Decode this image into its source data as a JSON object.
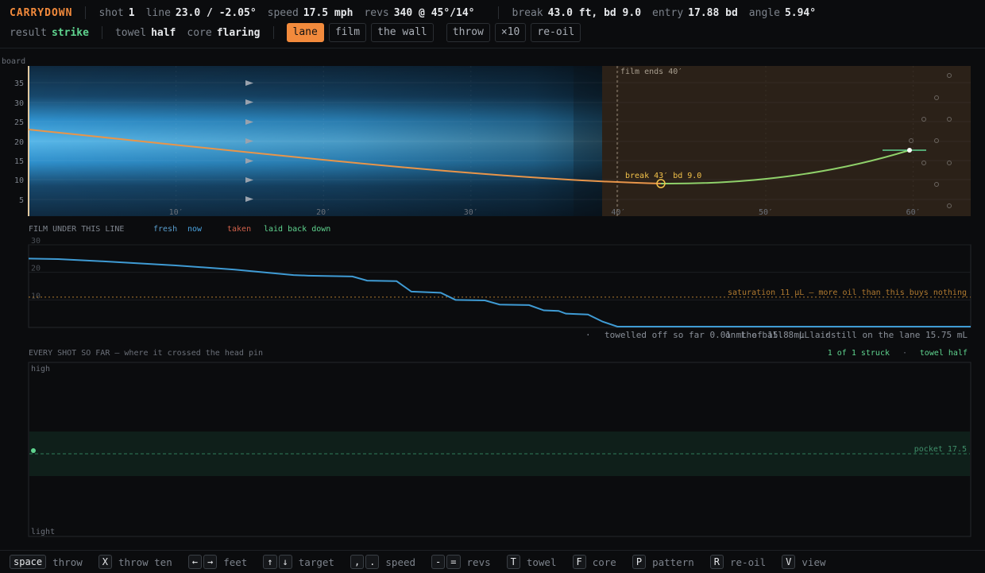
{
  "header": {
    "brand": "CARRYDOWN",
    "shot_label": "shot",
    "shot": "1",
    "line_label": "line",
    "line": "23.0 / -2.05°",
    "speed_label": "speed",
    "speed": "17.5 mph",
    "revs_label": "revs",
    "revs": "340 @ 45°/14°",
    "break_label": "break",
    "break": "43.0 ft, bd 9.0",
    "entry_label": "entry",
    "entry": "17.88 bd",
    "angle_label": "angle",
    "angle": "5.94°",
    "result_label": "result",
    "result": "strike",
    "towel_label": "towel",
    "towel": "half",
    "core_label": "core",
    "core": "flaring",
    "buttons": {
      "lane": "lane",
      "film": "film",
      "wall": "the wall",
      "throw": "throw",
      "x10": "×10",
      "reoil": "re-oil"
    }
  },
  "lane": {
    "axis_label": "board",
    "board_ticks": [
      "35",
      "30",
      "25",
      "20",
      "15",
      "10",
      "5"
    ],
    "feet_ticks": [
      "10′",
      "20′",
      "30′",
      "40′",
      "50′",
      "60′"
    ],
    "film_ends": "film ends 40′",
    "break_label": "break 43′ bd 9.0",
    "colors": {
      "oil": "#2a8fd0",
      "dry": "#2b2118",
      "path": "#e8954a",
      "hook": "#8fd06a",
      "break": "#f2c14a"
    }
  },
  "film": {
    "title": "FILM UNDER THIS LINE",
    "legend": {
      "fresh": "fresh",
      "now": "now",
      "taken": "taken",
      "laid": "laid back down"
    },
    "y_ticks": [
      "30",
      "20",
      "10"
    ],
    "saturation_note": "saturation 11 μL — more oil than this buys nothing",
    "stats": {
      "on_ball": "on the ball 8 μL",
      "towelled": "towelled off so far 0.01 mL of 15.8 mL laid",
      "still": "still on the lane 15.75 mL"
    },
    "dot": "·"
  },
  "shots": {
    "title": "EVERY SHOT SO FAR — where it crossed the head pin",
    "struck": "1 of 1 struck",
    "towel": "towel half",
    "high": "high",
    "light": "light",
    "pocket": "pocket 17.5"
  },
  "chart_data": [
    {
      "type": "line",
      "title": "FILM UNDER THIS LINE",
      "x_unit": "feet",
      "ylim": [
        0,
        30
      ],
      "series": [
        {
          "name": "now",
          "x": [
            0,
            2,
            5,
            10,
            14,
            18,
            19,
            22,
            23,
            25,
            26,
            28,
            29,
            31,
            32,
            34,
            35,
            36,
            36.5,
            38,
            39,
            40,
            64
          ],
          "y": [
            25,
            24.8,
            24,
            22.5,
            21,
            19,
            18.8,
            18.5,
            17,
            16.8,
            13,
            12.6,
            10,
            9.8,
            8.3,
            8.1,
            6.2,
            6,
            5,
            4.7,
            2.1,
            0.3,
            0.3
          ]
        }
      ],
      "annotations": [
        "saturation 11 μL — more oil than this buys nothing"
      ],
      "saturation": 11
    },
    {
      "type": "scatter",
      "title": "EVERY SHOT SO FAR — where it crossed the head pin",
      "series": [
        {
          "values": [
            17.5
          ]
        }
      ],
      "annotations": [
        "pocket 17.5"
      ]
    }
  ],
  "footer": [
    {
      "keys": [
        "space"
      ],
      "label": "throw"
    },
    {
      "keys": [
        "X"
      ],
      "label": "throw ten"
    },
    {
      "keys": [
        "←",
        "→"
      ],
      "label": "feet"
    },
    {
      "keys": [
        "↑",
        "↓"
      ],
      "label": "target"
    },
    {
      "keys": [
        ",",
        "."
      ],
      "label": "speed"
    },
    {
      "keys": [
        "-",
        "="
      ],
      "label": "revs"
    },
    {
      "keys": [
        "T"
      ],
      "label": "towel"
    },
    {
      "keys": [
        "F"
      ],
      "label": "core"
    },
    {
      "keys": [
        "P"
      ],
      "label": "pattern"
    },
    {
      "keys": [
        "R"
      ],
      "label": "re-oil"
    },
    {
      "keys": [
        "V"
      ],
      "label": "view"
    }
  ]
}
